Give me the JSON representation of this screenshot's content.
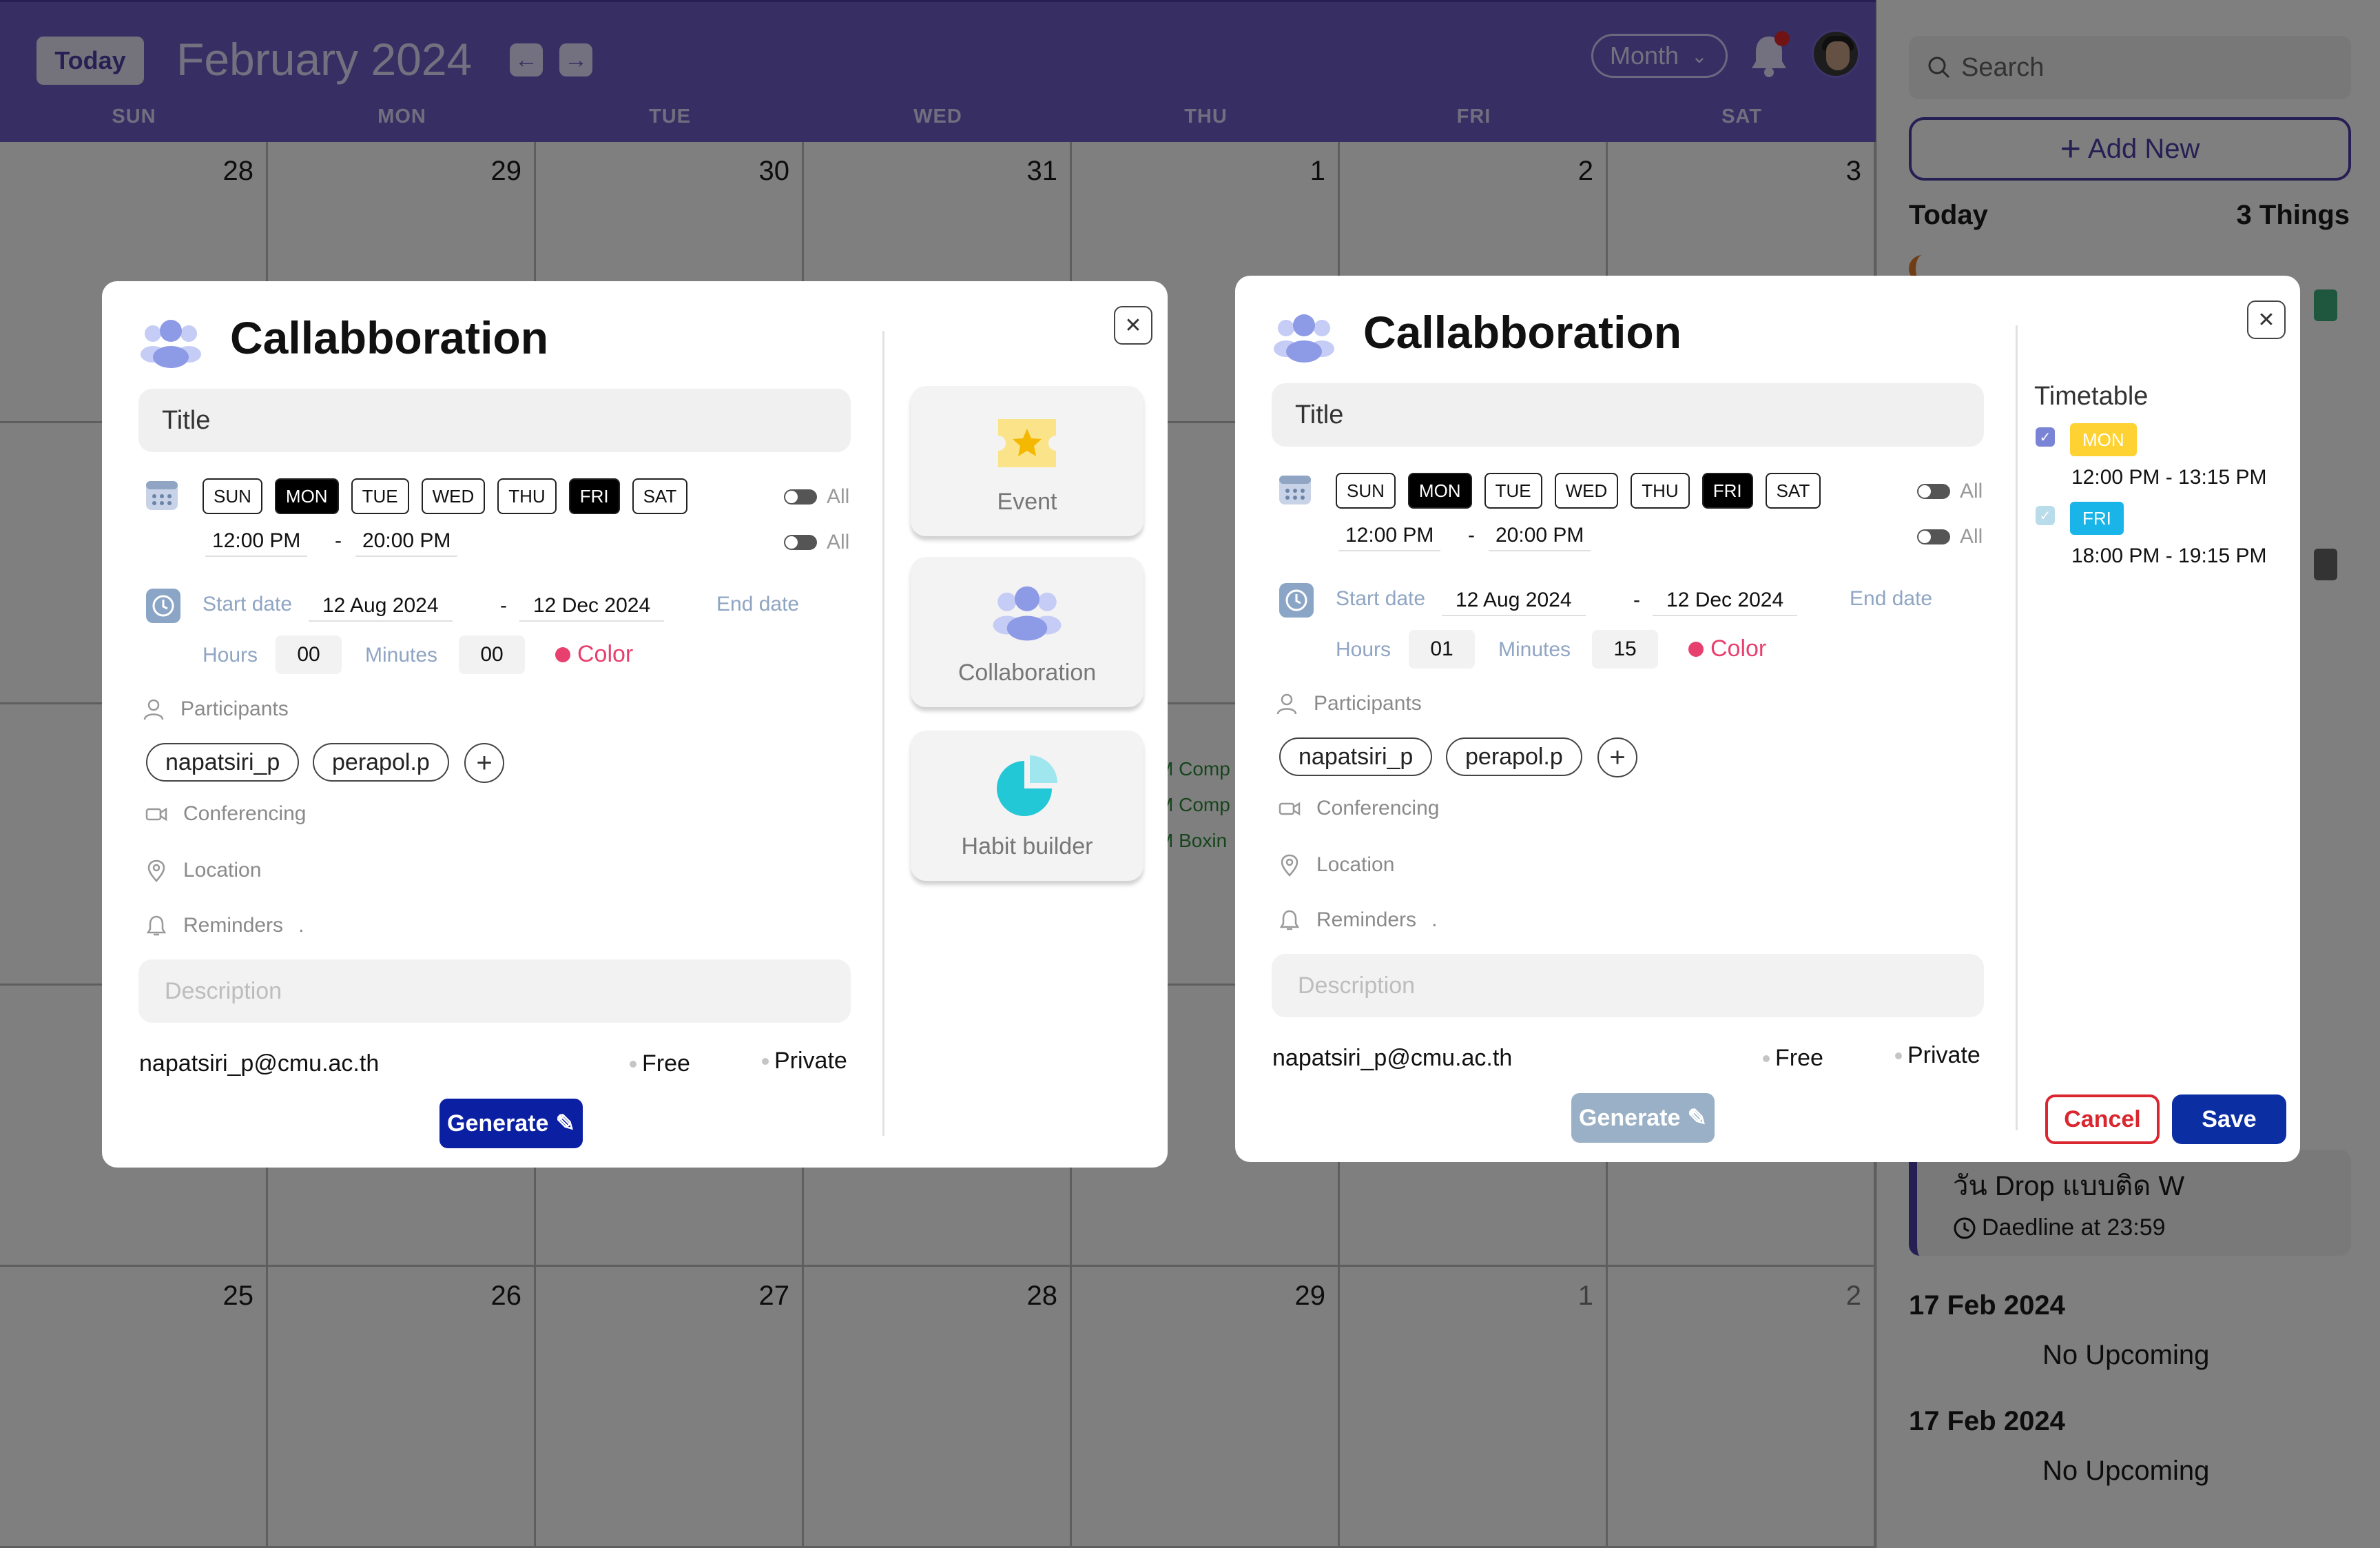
{
  "header": {
    "today_label": "Today",
    "month_title": "February 2024",
    "prev_icon": "arrow-left-icon",
    "next_icon": "arrow-right-icon",
    "view": "Month",
    "day_names": [
      "SUN",
      "MON",
      "TUE",
      "WED",
      "THU",
      "FRI",
      "SAT"
    ],
    "colors": {
      "header_bg": "#6f5cc9",
      "notification_dot": "#e0262b"
    }
  },
  "calendar": {
    "weeks": [
      [
        "28",
        "29",
        "30",
        "31",
        "1",
        "2",
        "3"
      ],
      [
        "",
        "",
        "",
        "",
        "",
        "",
        ""
      ],
      [
        "",
        "",
        "",
        "",
        "",
        "",
        ""
      ],
      [
        "",
        "",
        "",
        "",
        "",
        "",
        ""
      ],
      [
        "25",
        "26",
        "27",
        "28",
        "29",
        "1",
        "2"
      ]
    ],
    "partial_events": [
      "M Comp",
      "M Comp",
      "M Boxin"
    ]
  },
  "sidebar": {
    "search_placeholder": "Search",
    "add_new_label": "Add New",
    "today_label": "Today",
    "things_count": "3 Things",
    "card": {
      "title": "วัน Drop แบบติด W",
      "deadline": "Daedline at 23:59"
    },
    "upcoming": [
      {
        "date": "17 Feb 2024",
        "text": "No Upcoming"
      },
      {
        "date": "17 Feb 2024",
        "text": "No Upcoming"
      }
    ]
  },
  "modal_left": {
    "title": "Callabboration",
    "title_placeholder": "Title",
    "days": [
      "SUN",
      "MON",
      "TUE",
      "WED",
      "THU",
      "FRI",
      "SAT"
    ],
    "days_selected": [
      "MON",
      "FRI"
    ],
    "all_label": "All",
    "time_start": "12:00  PM",
    "time_end": "20:00  PM",
    "start_date_label": "Start date",
    "start_date": "12 Aug 2024",
    "end_date": "12 Dec 2024",
    "end_date_label": "End date",
    "hours_label": "Hours",
    "hours": "00",
    "minutes_label": "Minutes",
    "minutes": "00",
    "color_label": "Color",
    "participants_label": "Participants",
    "participants": [
      "napatsiri_p",
      "perapol.p"
    ],
    "conferencing_label": "Conferencing",
    "location_label": "Location",
    "reminders_label": "Reminders",
    "reminders_value": ".",
    "description_placeholder": "Description",
    "email": "napatsiri_p@cmu.ac.th",
    "free_label": "Free",
    "private_label": "Private",
    "generate_label": "Generate",
    "types": [
      "Event",
      "Collaboration",
      "Habit builder"
    ]
  },
  "modal_right": {
    "title": "Callabboration",
    "title_placeholder": "Title",
    "days": [
      "SUN",
      "MON",
      "TUE",
      "WED",
      "THU",
      "FRI",
      "SAT"
    ],
    "days_selected": [
      "MON",
      "FRI"
    ],
    "all_label": "All",
    "time_start": "12:00  PM",
    "time_end": "20:00  PM",
    "start_date_label": "Start date",
    "start_date": "12 Aug 2024",
    "end_date": "12 Dec 2024",
    "end_date_label": "End date",
    "hours_label": "Hours",
    "hours": "01",
    "minutes_label": "Minutes",
    "minutes": "15",
    "color_label": "Color",
    "participants_label": "Participants",
    "participants": [
      "napatsiri_p",
      "perapol.p"
    ],
    "conferencing_label": "Conferencing",
    "location_label": "Location",
    "reminders_label": "Reminders",
    "reminders_value": ".",
    "description_placeholder": "Description",
    "email": "napatsiri_p@cmu.ac.th",
    "free_label": "Free",
    "private_label": "Private",
    "generate_label": "Generate",
    "timetable": {
      "title": "Timetable",
      "items": [
        {
          "day": "MON",
          "time": "12:00  PM - 13:15 PM",
          "badge_color": "#ffd233"
        },
        {
          "day": "FRI",
          "time": "18:00  PM - 19:15 PM",
          "badge_color": "#1ab5e8"
        }
      ]
    },
    "cancel_label": "Cancel",
    "save_label": "Save"
  }
}
